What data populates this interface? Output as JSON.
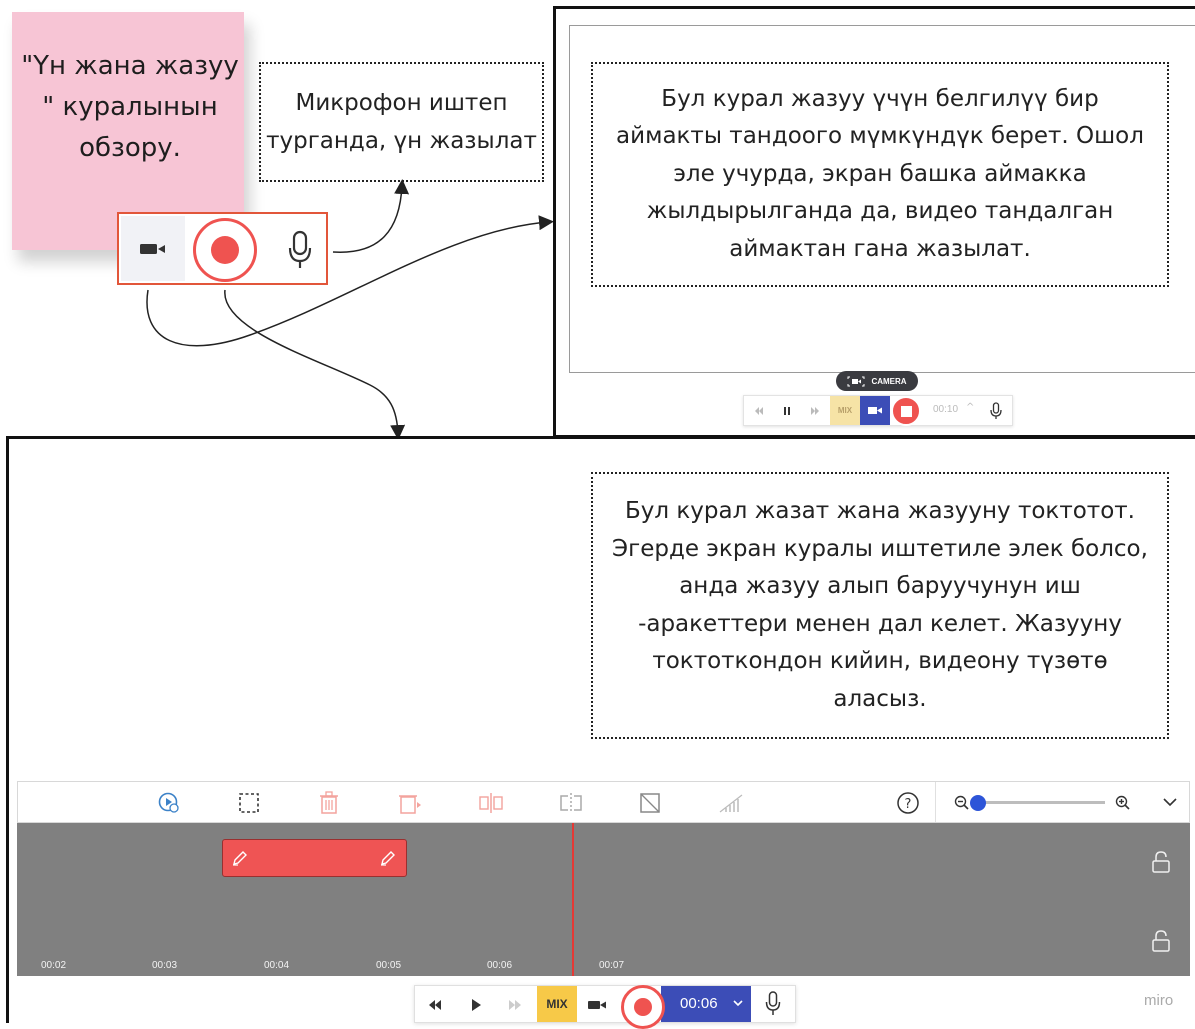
{
  "sticky_note": {
    "text": "\"Үн жана жазуу \" куралынын обзору."
  },
  "annotations": {
    "mic_note": "Микрофон иштеп турганда, үн жазылат",
    "area_note": "Бул курал жазуу үчүн белгилүү бир аймакты тандоого мүмкүндүк берет. Ошол эле учурда, экран башка аймакка жылдырылганда да, видео тандалган аймактан гана жазылат.",
    "stop_note": "Бул курал жазат жана жазууну токтотот. Эгерде экран куралы иштетиле элек болсо, анда жазуу алып баруучунун иш -аракеттери менен дал келет. Жазууну токтоткондон кийин, видеону түзөтө аласыз."
  },
  "camera_tooltip": {
    "label": "CAMERA"
  },
  "small_recorder": {
    "mix_label": "MIX",
    "time": "00:10"
  },
  "timeline": {
    "ticks": [
      "00:02",
      "00:03",
      "00:04",
      "00:05",
      "00:06",
      "00:07"
    ]
  },
  "main_recorder": {
    "mix_label": "MIX",
    "time": "00:06"
  },
  "zoom": {
    "level": 0.02
  },
  "brand": {
    "name": "miro"
  },
  "colors": {
    "record": "#ef5350",
    "camera_active": "#3c4db7",
    "mix": "#f7c948",
    "clip": "#ef5454"
  }
}
